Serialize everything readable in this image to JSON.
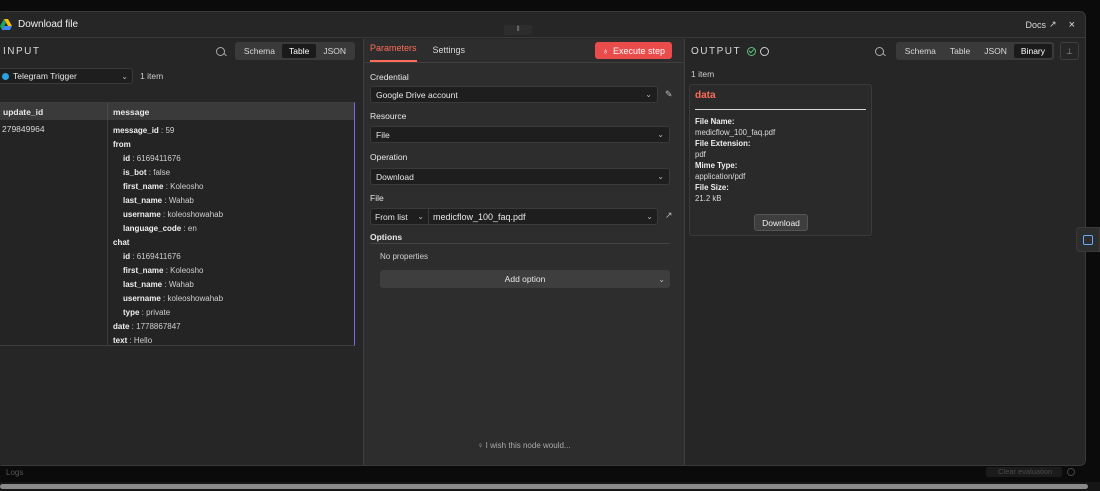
{
  "header": {
    "title": "Download file",
    "docs_label": "Docs",
    "close": "×"
  },
  "input": {
    "title": "INPUT",
    "views": [
      "Schema",
      "Table",
      "JSON"
    ],
    "active_view": "Table",
    "trigger": "Telegram Trigger",
    "item_count": "1 item",
    "columns": [
      "update_id",
      "message"
    ],
    "update_id": "279849964",
    "message_rows": [
      {
        "k": "message_id",
        "v": "59",
        "level": 0
      },
      {
        "k": "from",
        "v": "",
        "level": 0
      },
      {
        "k": "id",
        "v": "6169411676",
        "level": 1
      },
      {
        "k": "is_bot",
        "v": "false",
        "level": 1
      },
      {
        "k": "first_name",
        "v": "Koleosho",
        "level": 1
      },
      {
        "k": "last_name",
        "v": "Wahab",
        "level": 1
      },
      {
        "k": "username",
        "v": "koleoshowahab",
        "level": 1
      },
      {
        "k": "language_code",
        "v": "en",
        "level": 1
      },
      {
        "k": "chat",
        "v": "",
        "level": 0
      },
      {
        "k": "id",
        "v": "6169411676",
        "level": 1
      },
      {
        "k": "first_name",
        "v": "Koleosho",
        "level": 1
      },
      {
        "k": "last_name",
        "v": "Wahab",
        "level": 1
      },
      {
        "k": "username",
        "v": "koleoshowahab",
        "level": 1
      },
      {
        "k": "type",
        "v": "private",
        "level": 1
      },
      {
        "k": "date",
        "v": "1778867847",
        "level": 0
      },
      {
        "k": "text",
        "v": "Hello",
        "level": 0
      }
    ]
  },
  "params": {
    "tabs": [
      "Parameters",
      "Settings"
    ],
    "execute_label": "Execute step",
    "credential_label": "Credential",
    "credential_value": "Google Drive account",
    "resource_label": "Resource",
    "resource_value": "File",
    "operation_label": "Operation",
    "operation_value": "Download",
    "file_label": "File",
    "file_mode": "From list",
    "file_value": "medicflow_100_faq.pdf",
    "options_label": "Options",
    "no_properties": "No properties",
    "add_option": "Add option",
    "wish": "I wish this node would..."
  },
  "output": {
    "title": "OUTPUT",
    "views": [
      "Schema",
      "Table",
      "JSON",
      "Binary"
    ],
    "active_view": "Binary",
    "item_count": "1 item",
    "binary": {
      "title": "data",
      "file_name_label": "File Name:",
      "file_name": "medicflow_100_faq.pdf",
      "file_ext_label": "File Extension:",
      "file_ext": "pdf",
      "mime_label": "Mime Type:",
      "mime": "application/pdf",
      "size_label": "File Size:",
      "size": "21.2 kB",
      "download_label": "Download"
    }
  },
  "footer": {
    "logs": "Logs",
    "clear_eval": "Clear evaluation"
  },
  "colors": {
    "accent": "#ff6d5a",
    "execute": "#ea4b4b",
    "success": "#5bc27a"
  }
}
